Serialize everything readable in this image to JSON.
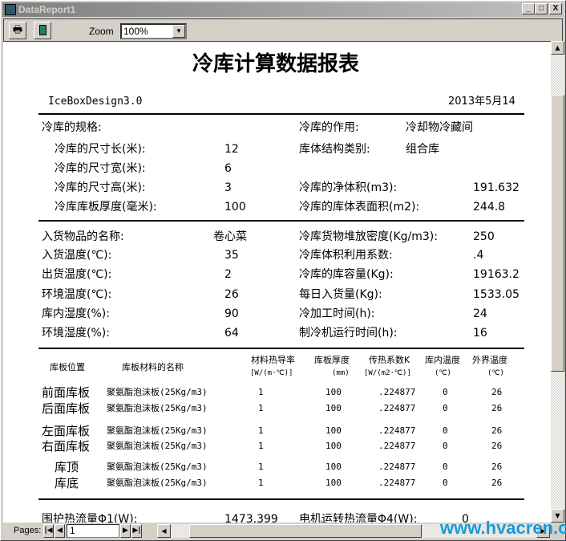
{
  "window": {
    "title": "DataReport1",
    "minimize": "_",
    "maximize": "□",
    "close": "X"
  },
  "toolbar": {
    "print_icon": "printer-icon",
    "export_icon": "export-icon",
    "zoom_label": "Zoom",
    "zoom_value": "100%"
  },
  "report": {
    "title": "冷库计算数据报表",
    "app_name": "IceBoxDesign3.0",
    "date": "2013年5月14",
    "section1": {
      "spec_label": "冷库的规格:",
      "purpose_label": "冷库的作用:",
      "purpose_value": "冷却物冷藏间",
      "length_label": "冷库的尺寸长(米):",
      "length_value": "12",
      "structure_label": "库体结构类别:",
      "structure_value": "组合库",
      "width_label": "冷库的尺寸宽(米):",
      "width_value": "6",
      "height_label": "冷库的尺寸高(米):",
      "height_value": "3",
      "net_volume_label": "冷库的净体积(m3):",
      "net_volume_value": "191.632",
      "panel_thickness_label": "冷库库板厚度(毫米):",
      "panel_thickness_value": "100",
      "surface_area_label": "冷库的库体表面积(m2):",
      "surface_area_value": "244.8"
    },
    "section2": {
      "goods_name_label": "入货物品的名称:",
      "goods_name_value": "卷心菜",
      "density_label": "冷库货物堆放密度(Kg/m3):",
      "density_value": "250",
      "in_temp_label": "入货温度(℃):",
      "in_temp_value": "35",
      "util_label": "冷库体积利用系数:",
      "util_value": ".4",
      "out_temp_label": "出货温度(℃):",
      "out_temp_value": "2",
      "capacity_label": "冷库的库容量(Kg):",
      "capacity_value": "19163.2",
      "env_temp_label": "环境温度(℃):",
      "env_temp_value": "26",
      "daily_in_label": "每日入货量(Kg):",
      "daily_in_value": "1533.05",
      "in_humidity_label": "库内湿度(%):",
      "in_humidity_value": "90",
      "process_time_label": "冷加工时间(h):",
      "process_time_value": "24",
      "env_humidity_label": "环境湿度(%):",
      "env_humidity_value": "64",
      "run_time_label": "制冷机运行时间(h):",
      "run_time_value": "16"
    },
    "table": {
      "headers": {
        "position": "库板位置",
        "material": "库板材料的名称",
        "conductivity": "材料热导率",
        "conductivity_unit": "[W/(m·℃)]",
        "thickness": "库板厚度",
        "thickness_unit": "(mm)",
        "k": "传热系数K",
        "k_unit": "[W/(m2·℃)]",
        "inner_temp": "库内温度",
        "inner_temp_unit": "(℃)",
        "outer_temp": "外界温度",
        "outer_temp_unit": "(℃)"
      },
      "rows": [
        {
          "position": "前面库板",
          "material": "聚氨酯泡沫板(25Kg/m3)",
          "conductivity": "1",
          "thickness": "100",
          "k": ".224877",
          "inner": "0",
          "outer": "26"
        },
        {
          "position": "后面库板",
          "material": "聚氨酯泡沫板(25Kg/m3)",
          "conductivity": "1",
          "thickness": "100",
          "k": ".224877",
          "inner": "0",
          "outer": "26"
        },
        {
          "position": "左面库板",
          "material": "聚氨酯泡沫板(25Kg/m3)",
          "conductivity": "1",
          "thickness": "100",
          "k": ".224877",
          "inner": "0",
          "outer": "26"
        },
        {
          "position": "右面库板",
          "material": "聚氨酯泡沫板(25Kg/m3)",
          "conductivity": "1",
          "thickness": "100",
          "k": ".224877",
          "inner": "0",
          "outer": "26"
        },
        {
          "position": "库顶",
          "material": "聚氨酯泡沫板(25Kg/m3)",
          "conductivity": "1",
          "thickness": "100",
          "k": ".224877",
          "inner": "0",
          "outer": "26"
        },
        {
          "position": "库底",
          "material": "聚氨酯泡沫板(25Kg/m3)",
          "conductivity": "1",
          "thickness": "100",
          "k": ".224877",
          "inner": "0",
          "outer": "26"
        }
      ]
    },
    "section3": {
      "heat_flow1_label": "围护热流量Φ1(W):",
      "heat_flow1_value": "1473.399",
      "heat_flow4_label": "电机运转热流量Φ4(W):",
      "heat_flow4_value": "0"
    }
  },
  "pager": {
    "label": "Pages:",
    "current": "1"
  },
  "watermark": "www.hvacren.cn"
}
